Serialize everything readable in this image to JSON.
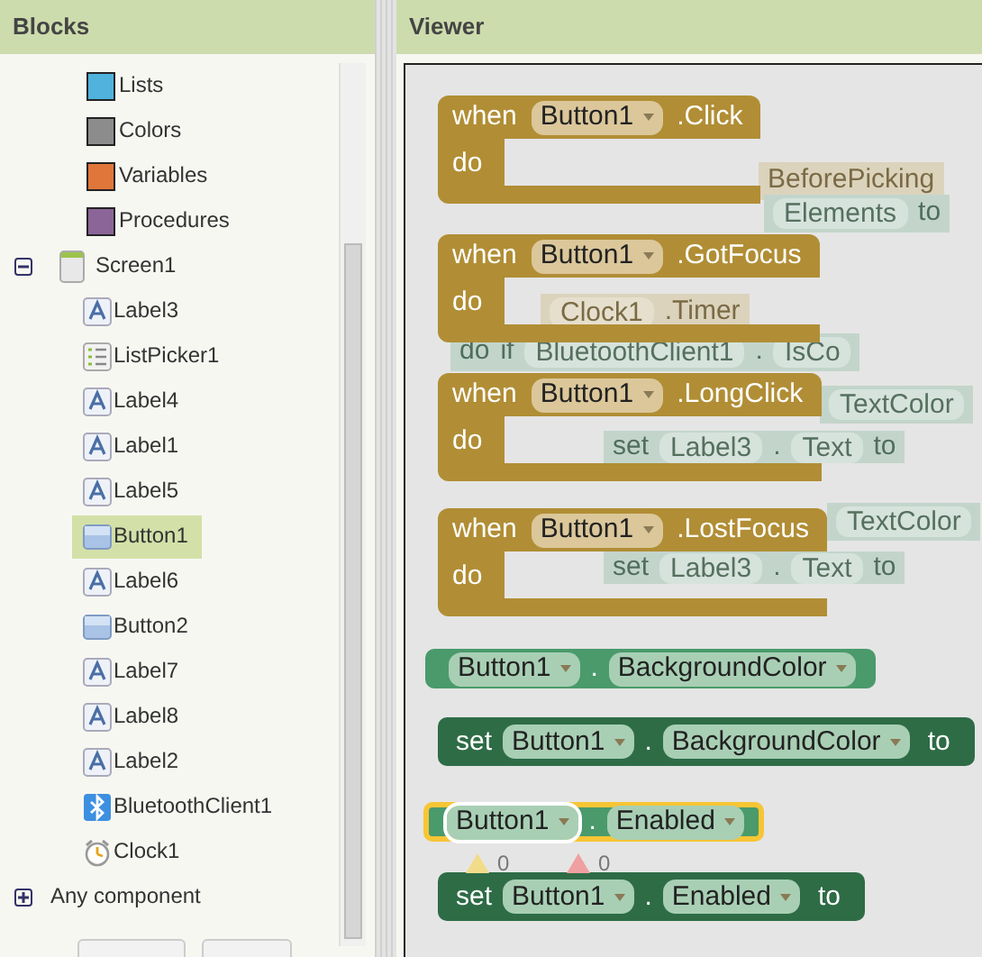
{
  "panels": {
    "blocks_title": "Blocks",
    "viewer_title": "Viewer"
  },
  "builtins": [
    {
      "label": "Lists",
      "color": "#4fb3de"
    },
    {
      "label": "Colors",
      "color": "#8c8c8c"
    },
    {
      "label": "Variables",
      "color": "#e0763a"
    },
    {
      "label": "Procedures",
      "color": "#8c6598"
    }
  ],
  "tree": {
    "label": "Screen1",
    "expanded": true,
    "children": [
      {
        "label": "Label3",
        "kind": "label",
        "selected": false
      },
      {
        "label": "ListPicker1",
        "kind": "listpicker",
        "selected": false
      },
      {
        "label": "Label4",
        "kind": "label",
        "selected": false
      },
      {
        "label": "Label1",
        "kind": "label",
        "selected": false
      },
      {
        "label": "Label5",
        "kind": "label",
        "selected": false
      },
      {
        "label": "Button1",
        "kind": "button",
        "selected": true
      },
      {
        "label": "Label6",
        "kind": "label",
        "selected": false
      },
      {
        "label": "Button2",
        "kind": "button",
        "selected": false
      },
      {
        "label": "Label7",
        "kind": "label",
        "selected": false
      },
      {
        "label": "Label8",
        "kind": "label",
        "selected": false
      },
      {
        "label": "Label2",
        "kind": "label",
        "selected": false
      },
      {
        "label": "BluetoothClient1",
        "kind": "bluetooth",
        "selected": false
      },
      {
        "label": "Clock1",
        "kind": "clock",
        "selected": false
      }
    ]
  },
  "any_component": {
    "label": "Any component",
    "expanded": false
  },
  "background_blocks": [
    {
      "kind": "event",
      "parts": [
        {
          "text": "BeforePicking",
          "pill": false
        }
      ]
    },
    {
      "kind": "statement",
      "parts": [
        {
          "text": "Elements",
          "pill": true
        },
        {
          "text": "to",
          "pill": false
        }
      ]
    },
    {
      "kind": "event",
      "parts": [
        {
          "text": "Clock1",
          "pill": true
        },
        {
          "text": ".Timer",
          "pill": false
        }
      ]
    },
    {
      "kind": "statement",
      "parts": [
        {
          "text": "do",
          "pill": false
        },
        {
          "text": "if",
          "pill": false
        },
        {
          "text": "BluetoothClient1",
          "pill": true
        },
        {
          "text": ".",
          "pill": false
        },
        {
          "text": "IsCo",
          "pill": true
        }
      ]
    },
    {
      "kind": "statement",
      "parts": [
        {
          "text": "TextColor",
          "pill": true
        }
      ]
    },
    {
      "kind": "statement",
      "parts": [
        {
          "text": "set",
          "pill": false
        },
        {
          "text": "Label3",
          "pill": true
        },
        {
          "text": ".",
          "pill": false
        },
        {
          "text": "Text",
          "pill": true
        },
        {
          "text": "to",
          "pill": false
        }
      ]
    },
    {
      "kind": "statement",
      "parts": [
        {
          "text": "TextColor",
          "pill": true
        }
      ]
    },
    {
      "kind": "statement",
      "parts": [
        {
          "text": "set",
          "pill": false
        },
        {
          "text": "Label3",
          "pill": true
        },
        {
          "text": ".",
          "pill": false
        },
        {
          "text": "Text",
          "pill": true
        },
        {
          "text": "to",
          "pill": false
        }
      ]
    }
  ],
  "blocks": [
    {
      "kind": "event",
      "keyword": "when",
      "component": "Button1",
      "event": ".Click",
      "do": "do"
    },
    {
      "kind": "event",
      "keyword": "when",
      "component": "Button1",
      "event": ".GotFocus",
      "do": "do"
    },
    {
      "kind": "event",
      "keyword": "when",
      "component": "Button1",
      "event": ".LongClick",
      "do": "do"
    },
    {
      "kind": "event",
      "keyword": "when",
      "component": "Button1",
      "event": ".LostFocus",
      "do": "do"
    },
    {
      "kind": "getter",
      "component": "Button1",
      "dot": ".",
      "property": "BackgroundColor",
      "selected": false
    },
    {
      "kind": "setter",
      "keyword": "set",
      "component": "Button1",
      "dot": ".",
      "property": "BackgroundColor",
      "to": "to"
    },
    {
      "kind": "getter",
      "component": "Button1",
      "dot": ".",
      "property": "Enabled",
      "selected": true
    },
    {
      "kind": "setter",
      "keyword": "set",
      "component": "Button1",
      "dot": ".",
      "property": "Enabled",
      "to": "to"
    }
  ],
  "indicators": [
    {
      "kind": "warning",
      "count": "0"
    },
    {
      "kind": "error",
      "count": "0"
    }
  ]
}
